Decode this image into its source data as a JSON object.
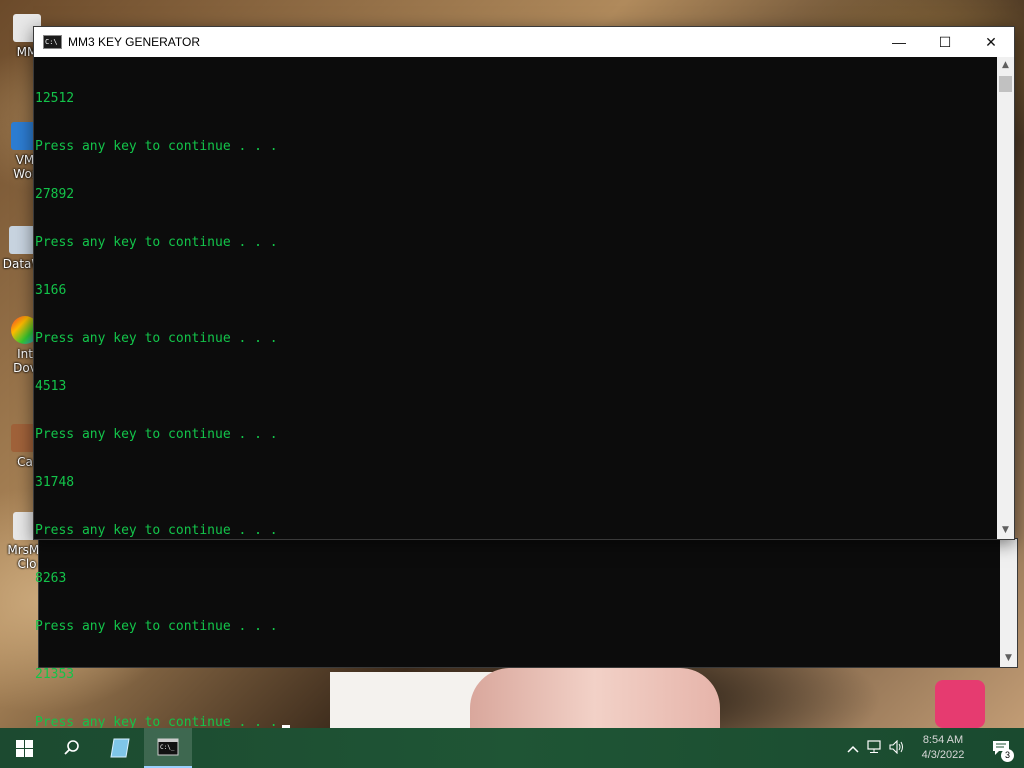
{
  "desktop": {
    "icons": [
      {
        "label_line1": "MM",
        "label_line2": ""
      },
      {
        "label_line1": "VM",
        "label_line2": "Wor"
      },
      {
        "label_line1": "DataW",
        "label_line2": ""
      },
      {
        "label_line1": "Int",
        "label_line2": "Dov"
      },
      {
        "label_line1": "Ca",
        "label_line2": ""
      },
      {
        "label_line1": "MrsMa",
        "label_line2": "Clo"
      }
    ]
  },
  "window": {
    "title": "MM3 KEY GENERATOR",
    "icon_text": "C:\\",
    "minimize": "—",
    "maximize": "☐",
    "close": "✕"
  },
  "console": {
    "lines": [
      "12512",
      "Press any key to continue . . .",
      "27892",
      "Press any key to continue . . .",
      "3166",
      "Press any key to continue . . .",
      "4513",
      "Press any key to continue . . .",
      "31748",
      "Press any key to continue . . .",
      "8263",
      "Press any key to continue . . .",
      "21353",
      "Press any key to continue . . ."
    ]
  },
  "scrollbar": {
    "up": "▲",
    "down": "▼"
  },
  "taskbar": {
    "search_icon": "⚲",
    "clock_time": "8:54 AM",
    "clock_date": "4/3/2022",
    "notification_count": "3"
  },
  "colors": {
    "console_text": "#13c44a",
    "console_bg": "#0c0c0c",
    "taskbar": "#1f5535"
  }
}
